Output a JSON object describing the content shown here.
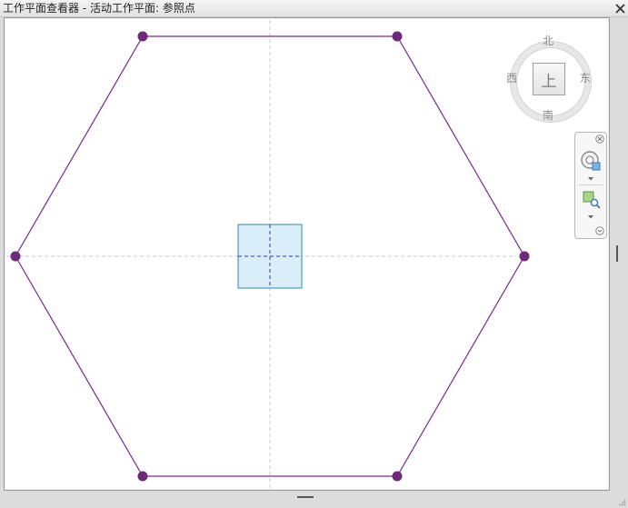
{
  "window": {
    "title": "工作平面查看器 - 活动工作平面: 参照点"
  },
  "viewcube": {
    "face_label": "上",
    "compass": {
      "north": "北",
      "south": "南",
      "east": "东",
      "west": "西"
    }
  },
  "colors": {
    "sketch_line": "#7a2a8c",
    "vertex": "#6e2a7a",
    "reference_square_fill": "#d9eef8",
    "reference_square_stroke": "#2a8ab0",
    "reference_axes": "#3a3aa8",
    "workplane_guides": "#c8c8d0"
  },
  "icons": {
    "close": "close-icon",
    "navbar_close": "small-close-icon",
    "steering_wheel": "steering-wheel-icon",
    "zoom": "zoom-region-icon",
    "dropdown": "chevron-down-icon",
    "options": "options-icon"
  }
}
